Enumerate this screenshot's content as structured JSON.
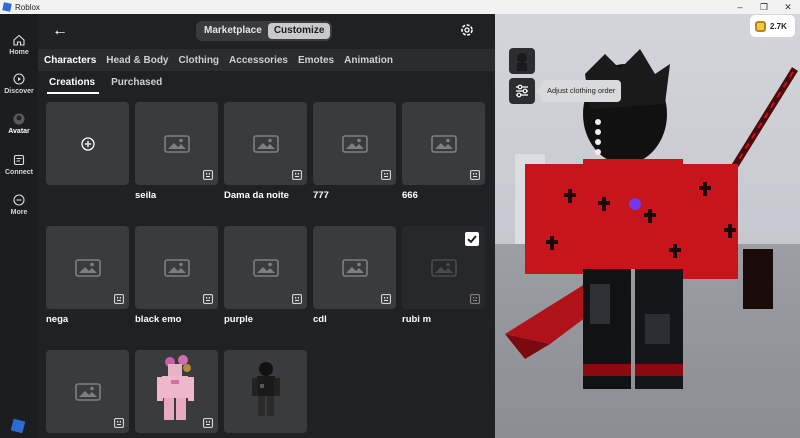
{
  "window": {
    "title": "Roblox",
    "controls": {
      "minimize": "–",
      "maximize": "❐",
      "close": "✕"
    }
  },
  "nav": {
    "items": [
      {
        "label": "Home",
        "icon": "home-icon"
      },
      {
        "label": "Discover",
        "icon": "discover-icon"
      },
      {
        "label": "Avatar",
        "icon": "avatar-icon"
      },
      {
        "label": "Connect",
        "icon": "chat-icon"
      },
      {
        "label": "More",
        "icon": "more-icon"
      }
    ]
  },
  "header": {
    "segments": [
      "Marketplace",
      "Customize"
    ],
    "selected": "Customize"
  },
  "tabs": [
    "Characters",
    "Head & Body",
    "Clothing",
    "Accessories",
    "Emotes",
    "Animation"
  ],
  "subtabs": [
    "Creations",
    "Purchased"
  ],
  "creations": [
    {
      "name": "",
      "type": "create"
    },
    {
      "name": "seila"
    },
    {
      "name": "Dama da noite"
    },
    {
      "name": "777"
    },
    {
      "name": "666"
    },
    {
      "name": "nega"
    },
    {
      "name": "black emo"
    },
    {
      "name": "purple"
    },
    {
      "name": "cdl"
    },
    {
      "name": "rubi m",
      "selected": true
    },
    {
      "name": ""
    },
    {
      "name": ""
    },
    {
      "name": ""
    }
  ],
  "robux": {
    "amount": "2.7K"
  },
  "tooltip": {
    "text": "Adjust clothing order"
  },
  "colors": {
    "accent_red": "#c8141b",
    "tile": "#393b3d",
    "panel": "#1f2225",
    "brand_blue": "#2b6bd6"
  }
}
